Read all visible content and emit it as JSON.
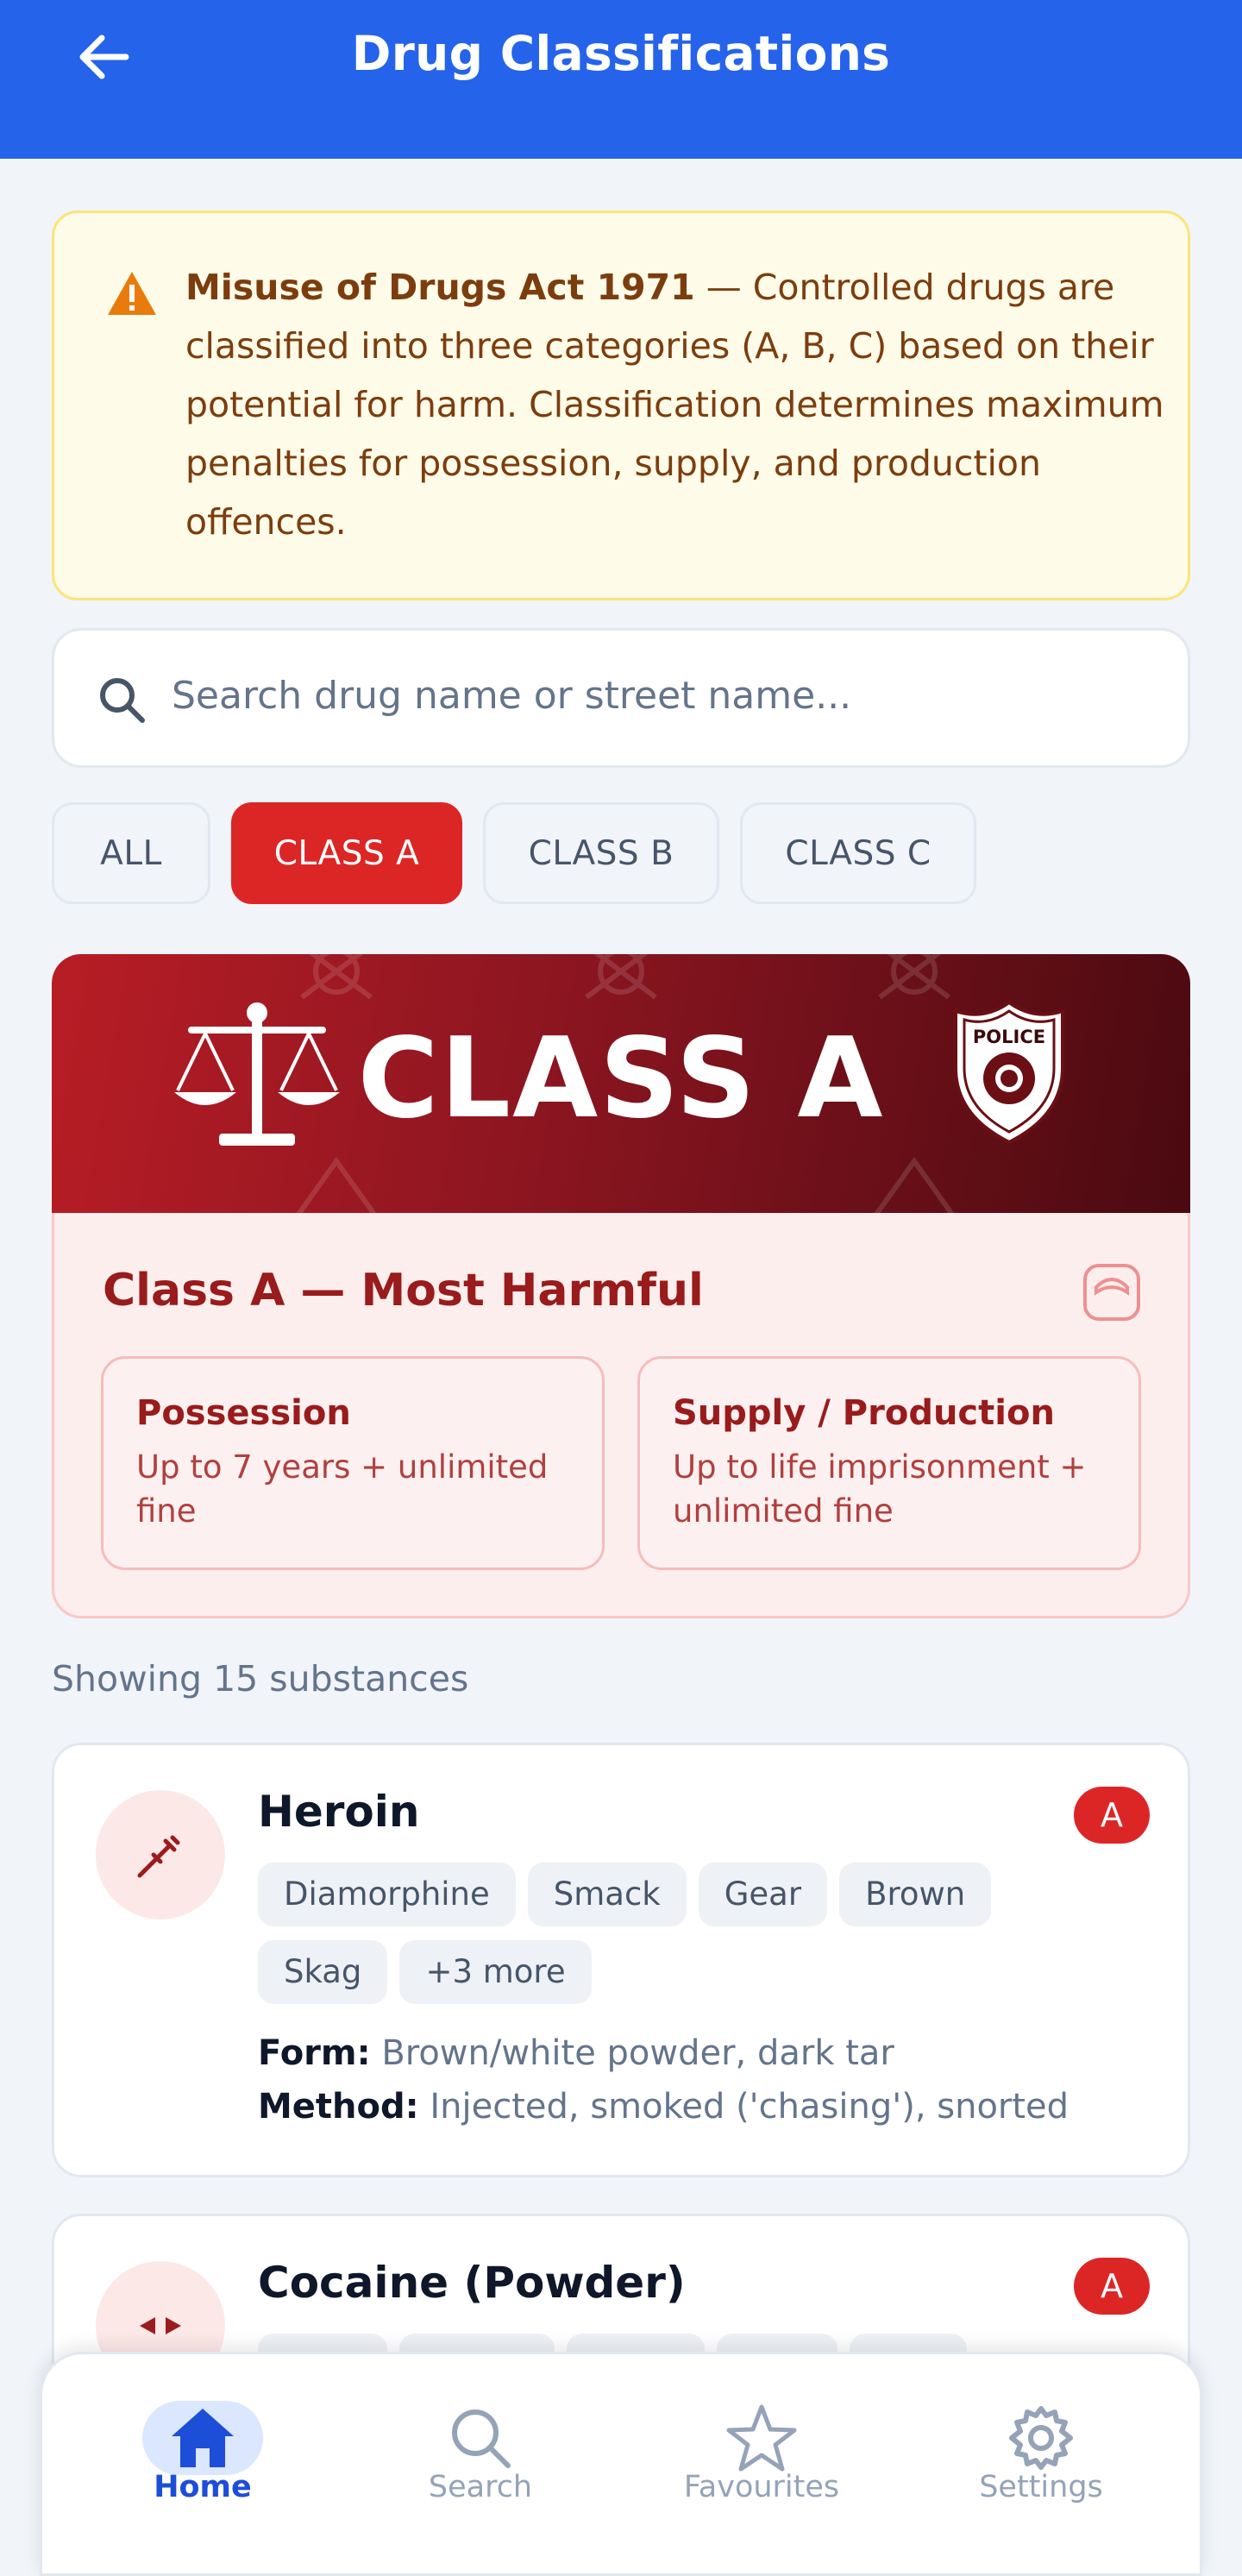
{
  "header": {
    "title": "Drug Classifications"
  },
  "notice": {
    "title": "Misuse of Drugs Act 1971",
    "body": " — Controlled drugs are classified into three categories (A, B, C) based on their potential for harm. Classification determines maximum penalties for possession, supply, and production offences."
  },
  "search": {
    "placeholder": "Search drug name or street name..."
  },
  "filters": [
    {
      "label": "ALL",
      "active": false
    },
    {
      "label": "CLASS A",
      "active": true
    },
    {
      "label": "CLASS B",
      "active": false
    },
    {
      "label": "CLASS C",
      "active": false
    }
  ],
  "banner": {
    "text": "CLASS A",
    "badge_text": "POLICE"
  },
  "class_card": {
    "title": "Class A — Most Harmful",
    "possession": {
      "label": "Possession",
      "value": "Up to 7 years + unlimited fine"
    },
    "supply": {
      "label": "Supply / Production",
      "value": "Up to life imprisonment + unlimited fine"
    }
  },
  "results": {
    "count_text": "Showing 15 substances"
  },
  "drugs": [
    {
      "name": "Heroin",
      "class": "A",
      "tags": [
        "Diamorphine",
        "Smack",
        "Gear",
        "Brown",
        "Skag",
        "+3 more"
      ],
      "form_label": "Form:",
      "form": "Brown/white powder, dark tar",
      "method_label": "Method:",
      "method": "Injected, smoked ('chasing'), snorted",
      "icon": "syringe-icon"
    },
    {
      "name": "Cocaine (Powder)",
      "class": "A",
      "icon": "pill-icon"
    }
  ],
  "nav": [
    {
      "label": "Home",
      "icon": "home-icon",
      "active": true
    },
    {
      "label": "Search",
      "icon": "search-icon",
      "active": false
    },
    {
      "label": "Favourites",
      "icon": "star-icon",
      "active": false
    },
    {
      "label": "Settings",
      "icon": "gear-icon",
      "active": false
    }
  ],
  "colors": {
    "primary": "#2563eb",
    "class_a": "#dc2626",
    "warning_bg": "#fefbe8"
  }
}
